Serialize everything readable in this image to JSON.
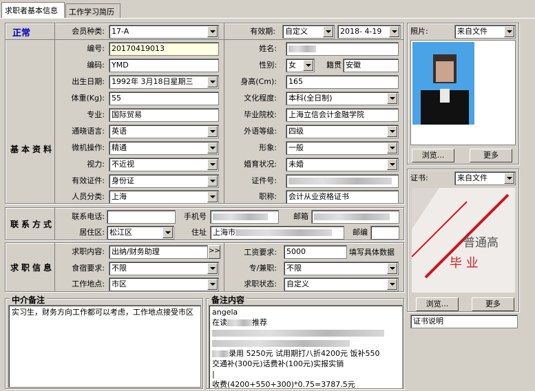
{
  "tabs": [
    "求职者基本信息",
    "工作学习简历"
  ],
  "status": "正常",
  "sections": {
    "basic": "基本资料",
    "contact": "联系方式",
    "job": "求职信息",
    "agent_notes": "中介备注",
    "notes": "备注内容"
  },
  "labels": {
    "member_type": "会员种类:",
    "validity": "有效期:",
    "number": "编号:",
    "name": "姓名:",
    "code": "编码:",
    "gender": "性别:",
    "origin": "籍贯",
    "birth": "出生日期:",
    "height": "身高(Cm):",
    "weight": "体重(Kg):",
    "education": "文化程度:",
    "major": "专业:",
    "school": "毕业院校:",
    "language": "通晓语言:",
    "foreign_level": "外语等级:",
    "computer": "微机操作:",
    "image": "形象:",
    "vision": "视力:",
    "marital": "婚育状况:",
    "id_type": "有效证件:",
    "id_no": "证件号:",
    "category": "人员分类:",
    "title": "职称:",
    "phone": "联系电话:",
    "mobile": "手机号",
    "email": "邮箱",
    "district": "居住区:",
    "address": "住址",
    "zip": "邮编",
    "job_content": "求职内容:",
    "salary": "工资要求:",
    "salary_note": "填写具体数据",
    "board": "食宿要求:",
    "parttime": "专/兼职:",
    "location": "工作地点:",
    "job_status": "求职状态:",
    "photo": "照片:",
    "cert": "证书:"
  },
  "values": {
    "member_type": "17-A",
    "validity_type": "自定义",
    "validity_date": "2018- 4-19",
    "number": "20170419013",
    "code": "YMD",
    "gender": "女",
    "origin": "安徽",
    "birth": "1992年 3月18日星期三",
    "height": "165",
    "weight": "55",
    "education": "本科(全日制)",
    "major": "国际贸易",
    "school": "上海立信会计金融学院",
    "language": "英语",
    "foreign_level": "四级",
    "computer": "精通",
    "image": "一般",
    "vision": "不近视",
    "marital": "未婚",
    "id_type": "身份证",
    "category": "上海",
    "title": "会计从业资格证书",
    "district": "松江区",
    "address_prefix": "上海市",
    "job_content": "出纳/财务助理",
    "salary": "5000",
    "board": "不限",
    "parttime": "不限",
    "location": "市区",
    "job_status": "自定义",
    "photo_source": "来自文件",
    "cert_source": "来自文件",
    "cert_desc": "证书说明"
  },
  "buttons": {
    "browse": "浏览...",
    "more": "更多",
    "expand": ">>"
  },
  "agent_notes": "实习生，财务方向工作都可以考虑，工作地点接受市区",
  "notes_lines": [
    "angela",
    "在读",
    "推荐",
    "",
    "",
    "录用 5250元 试用期打八折4200元 饭补550",
    "交通补(300元)话费补(100元)实报实销",
    "",
    "收费(4200+550+300)*0.75=3787.5元"
  ],
  "cert_image_text": [
    "普通高",
    "毕 业"
  ],
  "colors": {
    "status": "#0000c0",
    "bg": "#d4d0c8"
  }
}
